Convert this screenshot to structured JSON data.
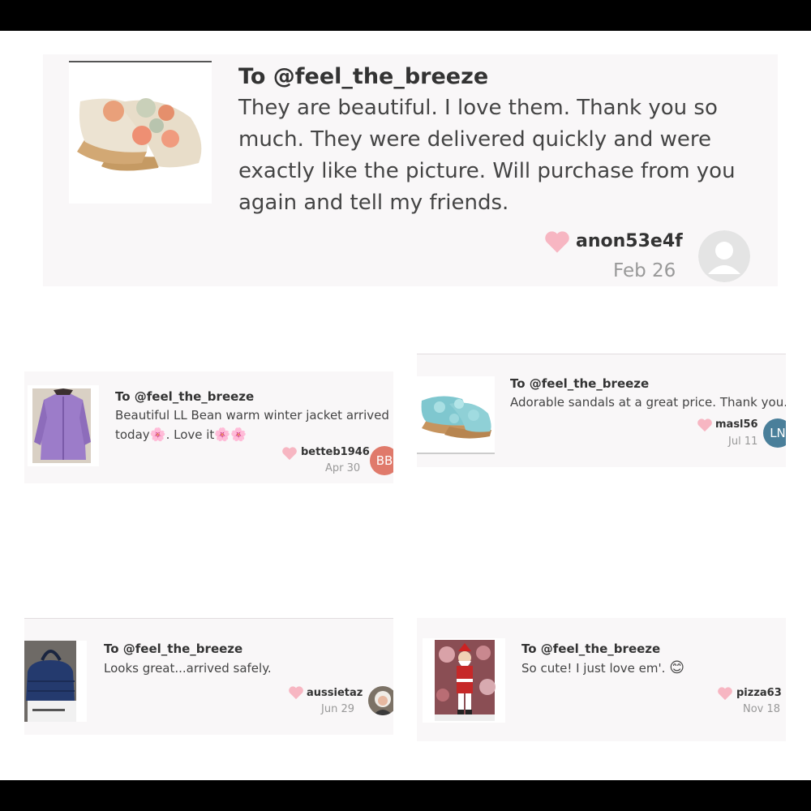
{
  "reviews": [
    {
      "to": "To @feel_the_breeze",
      "message": "They are beautiful. I love them. Thank you so much. They were delivered quickly and were exactly like the picture. Will purchase from you again and tell my friends.",
      "user": "anon53e4f",
      "date": "Feb 26",
      "avatar": "default-user-icon",
      "thumb": "floral-wedge-sandals-beige"
    },
    {
      "to": "To @feel_the_breeze",
      "message_part1": "Beautiful LL Bean warm winter jacket arrived",
      "message_part2": "today",
      "message_part3": ". Love it",
      "emoji": "🌸",
      "user": "betteb1946",
      "date": "Apr 30",
      "avatar_initials": "BB",
      "avatar_color": "#e07a6b",
      "thumb": "purple-winter-jacket"
    },
    {
      "to": "To @feel_the_breeze",
      "message": "Adorable sandals at a great price. Thank you.",
      "user": "masl56",
      "date": "Jul 11",
      "avatar_initials": "LN",
      "avatar_color": "#4a7f9a",
      "thumb": "floral-wedge-sandals-teal"
    },
    {
      "to": "To @feel_the_breeze",
      "message": "Looks great...arrived safely.",
      "user": "aussietaz",
      "date": "Jun 29",
      "avatar": "photo-avatar",
      "thumb": "blue-croc-handbag"
    },
    {
      "to": "To @feel_the_breeze",
      "message": "So cute! I just love em'.",
      "emoji": "😊",
      "user": "pizza63",
      "date": "Nov 18",
      "thumb": "santa-figurine"
    }
  ],
  "colors": {
    "heart": "#f7b6c2",
    "card_bg": "#f9f7f8",
    "bar": "#000000"
  }
}
